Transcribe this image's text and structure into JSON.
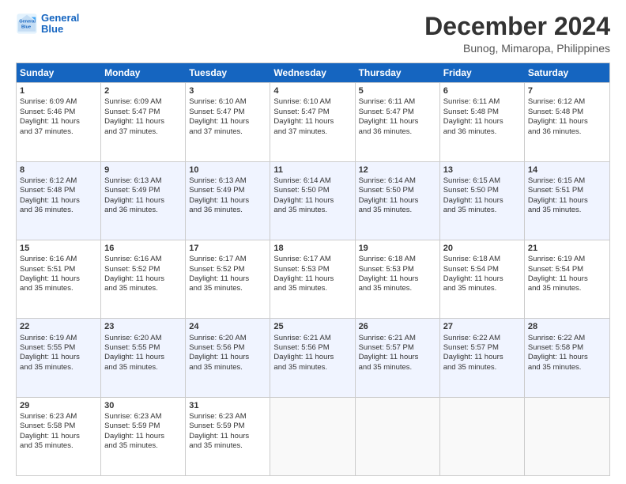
{
  "logo": {
    "line1": "General",
    "line2": "Blue"
  },
  "title": "December 2024",
  "subtitle": "Bunog, Mimaropa, Philippines",
  "days": [
    "Sunday",
    "Monday",
    "Tuesday",
    "Wednesday",
    "Thursday",
    "Friday",
    "Saturday"
  ],
  "weeks": [
    [
      {
        "day": "1",
        "sunrise": "6:09 AM",
        "sunset": "5:46 PM",
        "daylight": "11 hours and 37 minutes."
      },
      {
        "day": "2",
        "sunrise": "6:09 AM",
        "sunset": "5:47 PM",
        "daylight": "11 hours and 37 minutes."
      },
      {
        "day": "3",
        "sunrise": "6:10 AM",
        "sunset": "5:47 PM",
        "daylight": "11 hours and 37 minutes."
      },
      {
        "day": "4",
        "sunrise": "6:10 AM",
        "sunset": "5:47 PM",
        "daylight": "11 hours and 37 minutes."
      },
      {
        "day": "5",
        "sunrise": "6:11 AM",
        "sunset": "5:47 PM",
        "daylight": "11 hours and 36 minutes."
      },
      {
        "day": "6",
        "sunrise": "6:11 AM",
        "sunset": "5:48 PM",
        "daylight": "11 hours and 36 minutes."
      },
      {
        "day": "7",
        "sunrise": "6:12 AM",
        "sunset": "5:48 PM",
        "daylight": "11 hours and 36 minutes."
      }
    ],
    [
      {
        "day": "8",
        "sunrise": "6:12 AM",
        "sunset": "5:48 PM",
        "daylight": "11 hours and 36 minutes."
      },
      {
        "day": "9",
        "sunrise": "6:13 AM",
        "sunset": "5:49 PM",
        "daylight": "11 hours and 36 minutes."
      },
      {
        "day": "10",
        "sunrise": "6:13 AM",
        "sunset": "5:49 PM",
        "daylight": "11 hours and 36 minutes."
      },
      {
        "day": "11",
        "sunrise": "6:14 AM",
        "sunset": "5:50 PM",
        "daylight": "11 hours and 35 minutes."
      },
      {
        "day": "12",
        "sunrise": "6:14 AM",
        "sunset": "5:50 PM",
        "daylight": "11 hours and 35 minutes."
      },
      {
        "day": "13",
        "sunrise": "6:15 AM",
        "sunset": "5:50 PM",
        "daylight": "11 hours and 35 minutes."
      },
      {
        "day": "14",
        "sunrise": "6:15 AM",
        "sunset": "5:51 PM",
        "daylight": "11 hours and 35 minutes."
      }
    ],
    [
      {
        "day": "15",
        "sunrise": "6:16 AM",
        "sunset": "5:51 PM",
        "daylight": "11 hours and 35 minutes."
      },
      {
        "day": "16",
        "sunrise": "6:16 AM",
        "sunset": "5:52 PM",
        "daylight": "11 hours and 35 minutes."
      },
      {
        "day": "17",
        "sunrise": "6:17 AM",
        "sunset": "5:52 PM",
        "daylight": "11 hours and 35 minutes."
      },
      {
        "day": "18",
        "sunrise": "6:17 AM",
        "sunset": "5:53 PM",
        "daylight": "11 hours and 35 minutes."
      },
      {
        "day": "19",
        "sunrise": "6:18 AM",
        "sunset": "5:53 PM",
        "daylight": "11 hours and 35 minutes."
      },
      {
        "day": "20",
        "sunrise": "6:18 AM",
        "sunset": "5:54 PM",
        "daylight": "11 hours and 35 minutes."
      },
      {
        "day": "21",
        "sunrise": "6:19 AM",
        "sunset": "5:54 PM",
        "daylight": "11 hours and 35 minutes."
      }
    ],
    [
      {
        "day": "22",
        "sunrise": "6:19 AM",
        "sunset": "5:55 PM",
        "daylight": "11 hours and 35 minutes."
      },
      {
        "day": "23",
        "sunrise": "6:20 AM",
        "sunset": "5:55 PM",
        "daylight": "11 hours and 35 minutes."
      },
      {
        "day": "24",
        "sunrise": "6:20 AM",
        "sunset": "5:56 PM",
        "daylight": "11 hours and 35 minutes."
      },
      {
        "day": "25",
        "sunrise": "6:21 AM",
        "sunset": "5:56 PM",
        "daylight": "11 hours and 35 minutes."
      },
      {
        "day": "26",
        "sunrise": "6:21 AM",
        "sunset": "5:57 PM",
        "daylight": "11 hours and 35 minutes."
      },
      {
        "day": "27",
        "sunrise": "6:22 AM",
        "sunset": "5:57 PM",
        "daylight": "11 hours and 35 minutes."
      },
      {
        "day": "28",
        "sunrise": "6:22 AM",
        "sunset": "5:58 PM",
        "daylight": "11 hours and 35 minutes."
      }
    ],
    [
      {
        "day": "29",
        "sunrise": "6:23 AM",
        "sunset": "5:58 PM",
        "daylight": "11 hours and 35 minutes."
      },
      {
        "day": "30",
        "sunrise": "6:23 AM",
        "sunset": "5:59 PM",
        "daylight": "11 hours and 35 minutes."
      },
      {
        "day": "31",
        "sunrise": "6:23 AM",
        "sunset": "5:59 PM",
        "daylight": "11 hours and 35 minutes."
      },
      null,
      null,
      null,
      null
    ]
  ]
}
